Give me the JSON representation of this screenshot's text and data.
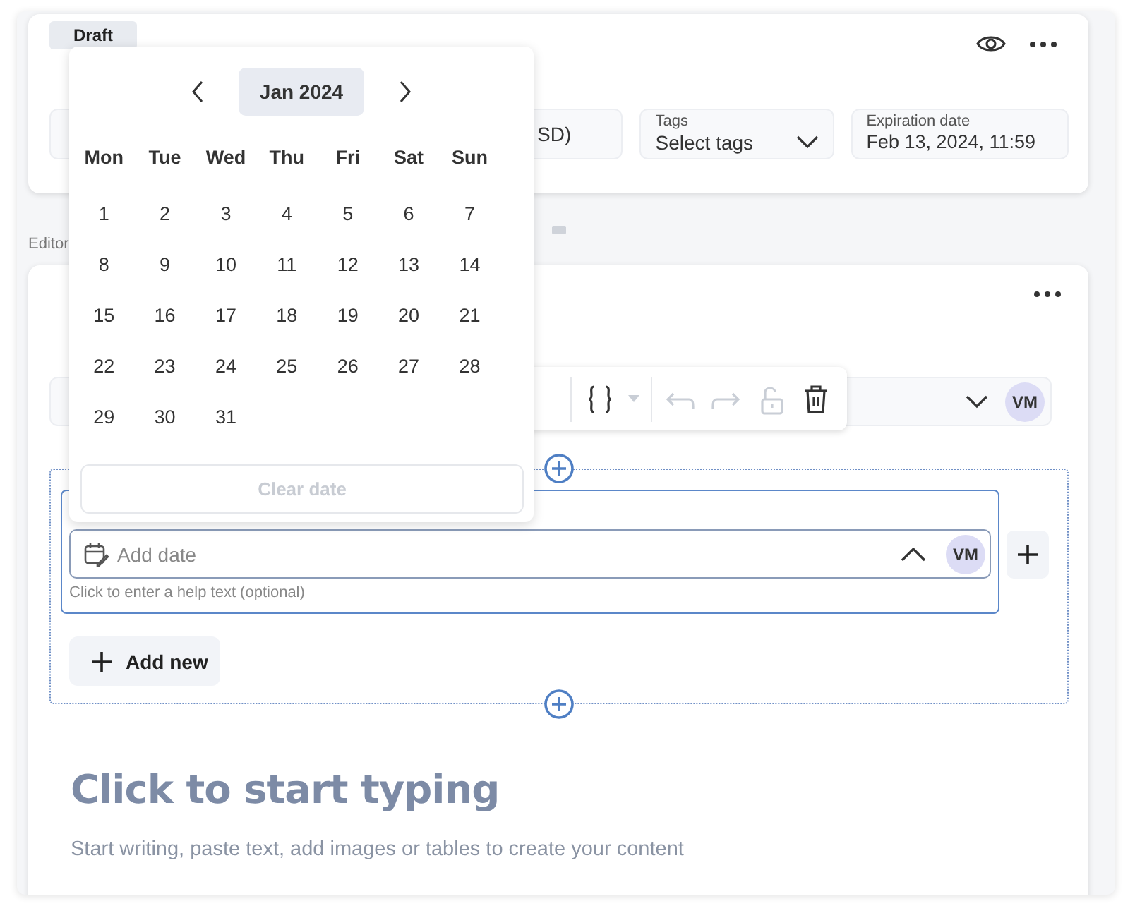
{
  "header": {
    "status_badge": "Draft"
  },
  "top_fields": [
    {
      "kind": "plain",
      "value": "SD)"
    },
    {
      "kind": "select",
      "label": "Tags",
      "value": "Select tags",
      "expanded": false
    },
    {
      "kind": "labeled",
      "label": "Expiration date",
      "value": "Feb 13, 2024, 11:59"
    }
  ],
  "section_label": "Editor",
  "editor": {
    "user_field": {
      "avatar": "VM",
      "expanded": false
    },
    "toolbar": [
      {
        "kind": "braces",
        "disabled": false
      },
      {
        "kind": "undo",
        "disabled": true
      },
      {
        "kind": "redo",
        "disabled": true
      },
      {
        "kind": "unlock",
        "disabled": true
      },
      {
        "kind": "trash",
        "disabled": false
      }
    ],
    "date_field": {
      "placeholder": "Add date",
      "expanded": true,
      "avatar": "VM",
      "help_text": "Click to enter a help text (optional)",
      "selected": true
    },
    "add_button": "Add new",
    "heading": "Click to start typing",
    "subtext": "Start writing, paste text, add images or tables to create your content"
  },
  "date_picker": {
    "month": "Jan 2024",
    "weekdays": [
      "Mon",
      "Tue",
      "Wed",
      "Thu",
      "Fri",
      "Sat",
      "Sun"
    ],
    "days": [
      "1",
      "2",
      "3",
      "4",
      "5",
      "6",
      "7",
      "8",
      "9",
      "10",
      "11",
      "12",
      "13",
      "14",
      "15",
      "16",
      "17",
      "18",
      "19",
      "20",
      "21",
      "22",
      "23",
      "24",
      "25",
      "26",
      "27",
      "28",
      "29",
      "30",
      "31"
    ],
    "clear_button": {
      "label": "Clear date",
      "disabled": true
    }
  }
}
